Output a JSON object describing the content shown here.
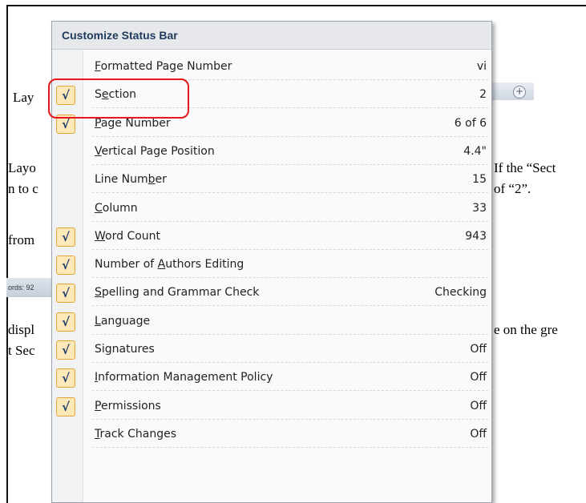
{
  "doc": {
    "lines": [
      "Lay",
      "Layo",
      "n to c",
      "from",
      "displ",
      "t Sec",
      "If the “Sect",
      "of “2”.",
      "e on the gre"
    ],
    "statusbar_fragment": "ords: 92"
  },
  "menu": {
    "title": "Customize Status Bar",
    "items": [
      {
        "pre": "",
        "ul": "F",
        "post": "ormatted Page Number",
        "value": "vi",
        "checked": false
      },
      {
        "pre": "S",
        "ul": "e",
        "post": "ction",
        "value": "2",
        "checked": true
      },
      {
        "pre": "",
        "ul": "P",
        "post": "age Number",
        "value": "6 of 6",
        "checked": true
      },
      {
        "pre": "",
        "ul": "V",
        "post": "ertical Page Position",
        "value": "4.4\"",
        "checked": false
      },
      {
        "pre": "Line Num",
        "ul": "b",
        "post": "er",
        "value": "15",
        "checked": false
      },
      {
        "pre": "",
        "ul": "C",
        "post": "olumn",
        "value": "33",
        "checked": false
      },
      {
        "pre": "",
        "ul": "W",
        "post": "ord Count",
        "value": "943",
        "checked": true
      },
      {
        "pre": "Number of ",
        "ul": "A",
        "post": "uthors Editing",
        "value": "",
        "checked": true
      },
      {
        "pre": "",
        "ul": "S",
        "post": "pelling and Grammar Check",
        "value": "Checking",
        "checked": true
      },
      {
        "pre": "",
        "ul": "L",
        "post": "anguage",
        "value": "",
        "checked": true
      },
      {
        "pre": "Si",
        "ul": "g",
        "post": "natures",
        "value": "Off",
        "checked": true
      },
      {
        "pre": "",
        "ul": "I",
        "post": "nformation Management Policy",
        "value": "Off",
        "checked": true
      },
      {
        "pre": "",
        "ul": "P",
        "post": "ermissions",
        "value": "Off",
        "checked": true
      },
      {
        "pre": "",
        "ul": "T",
        "post": "rack Changes",
        "value": "Off",
        "checked": false
      }
    ]
  },
  "check_glyph": "√",
  "zoom_glyph": "+"
}
